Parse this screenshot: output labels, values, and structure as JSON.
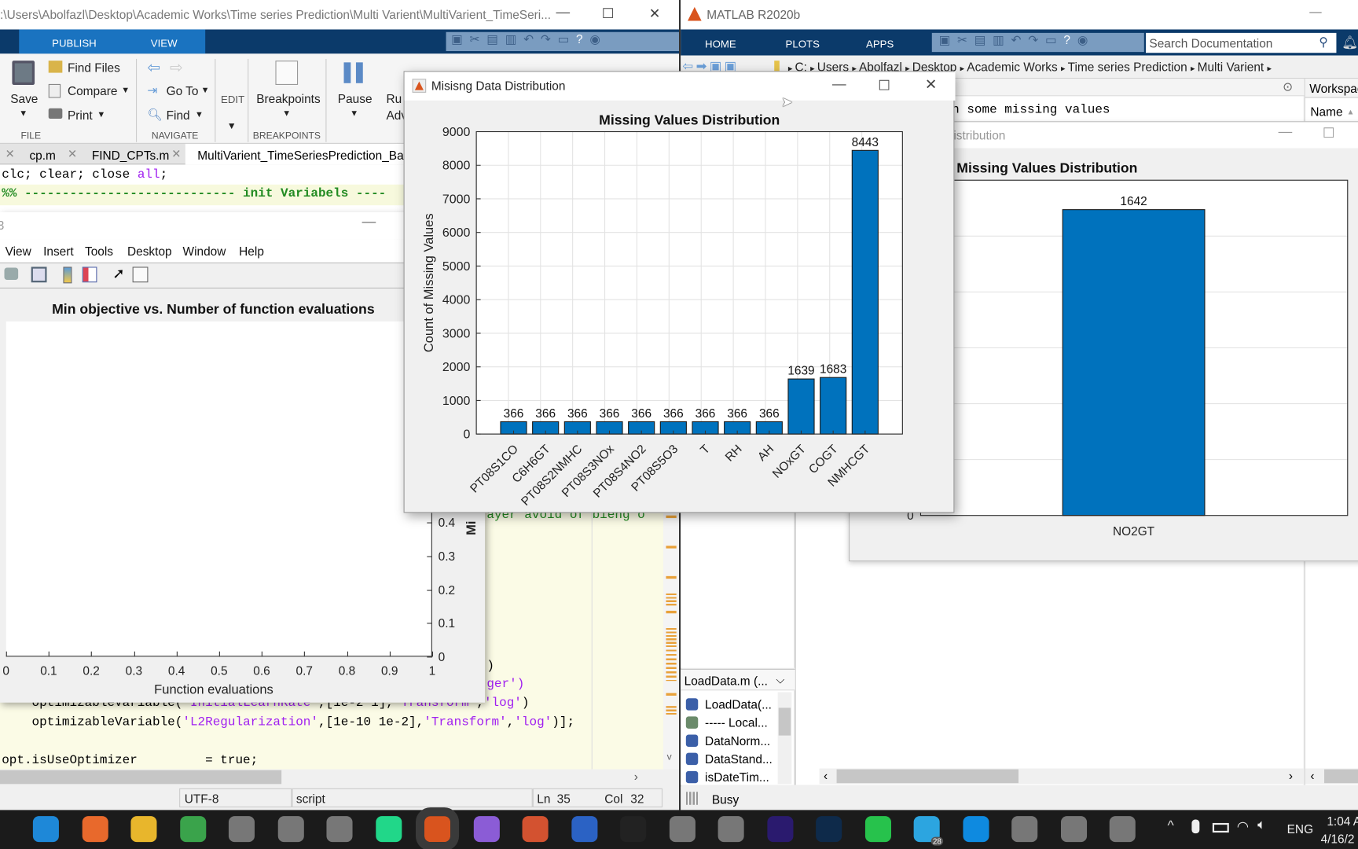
{
  "editor_window": {
    "title": ":\\Users\\Abolfazl\\Desktop\\Academic Works\\Time series Prediction\\Multi Varient\\MultiVarient_TimeSeri...",
    "tabs": [
      "PUBLISH",
      "VIEW"
    ],
    "ribbon": {
      "save": "Save",
      "find_files": "Find Files",
      "compare": "Compare",
      "print": "Print",
      "go_to": "Go To",
      "find": "Find",
      "edit": "EDIT",
      "breakpoints": "Breakpoints",
      "pause": "Pause",
      "run_adv_1": "Ru",
      "run_adv_2": "Adv",
      "groups": {
        "file": "FILE",
        "navigate": "NAVIGATE",
        "breakpoints": "BREAKPOINTS"
      }
    },
    "file_tabs": [
      "cp.m",
      "FIND_CPTs.m",
      "MultiVarient_TimeSeriesPrediction_Baye"
    ],
    "code": {
      "line1": [
        {
          "t": "clc; clear; close ",
          "k": ""
        },
        {
          "t": "all",
          "k": "str"
        },
        {
          "t": ";",
          "k": ""
        }
      ],
      "line2": "%% ---------------------------- init Variabels ----",
      "comment_partial": "ayer avoid of bieng o",
      "paren1": ")",
      "paren2a": "ger",
      "paren2b": "')",
      "line_ilr": [
        {
          "t": "    optimizableVariable(",
          "k": ""
        },
        {
          "t": "'InitialLearnRate'",
          "k": "str"
        },
        {
          "t": ",[1e-2 1],",
          "k": ""
        },
        {
          "t": "'Transform'",
          "k": "str"
        },
        {
          "t": ",",
          "k": ""
        },
        {
          "t": "'log'",
          "k": "str"
        },
        {
          "t": ")",
          "k": ""
        }
      ],
      "line_l2": [
        {
          "t": "    optimizableVariable(",
          "k": ""
        },
        {
          "t": "'L2Regularization'",
          "k": "str"
        },
        {
          "t": ",[1e-10 1e-2],",
          "k": ""
        },
        {
          "t": "'Transform'",
          "k": "str"
        },
        {
          "t": ",",
          "k": ""
        },
        {
          "t": "'log'",
          "k": "str"
        },
        {
          "t": ")];",
          "k": ""
        }
      ],
      "line_opt": "opt.isUseOptimizer         = true;"
    },
    "status": {
      "encoding": "UTF-8",
      "type": "script",
      "ln_label": "Ln",
      "ln": "35",
      "col_label": "Col",
      "col": "32"
    }
  },
  "bayes_figure": {
    "title_frag": "3",
    "menu": [
      "View",
      "Insert",
      "Tools",
      "Desktop",
      "Window",
      "Help"
    ],
    "plot_title": "Min objective vs. Number of function evaluations",
    "xlabel": "Function evaluations",
    "ylabel_partial": "Mi",
    "xticks": [
      "0",
      "0.1",
      "0.2",
      "0.3",
      "0.4",
      "0.5",
      "0.6",
      "0.7",
      "0.8",
      "0.9",
      "1"
    ],
    "yticks": [
      "0",
      "0.1",
      "0.2",
      "0.3",
      "0.4"
    ]
  },
  "matlab_window": {
    "title": "MATLAB R2020b",
    "tabs": [
      "HOME",
      "PLOTS",
      "APPS"
    ],
    "search_placeholder": "Search Documentation",
    "breadcrumb": [
      "C:",
      "Users",
      "Abolfazl",
      "Desktop",
      "Academic Works",
      "Time series Prediction",
      "Multi Varient"
    ],
    "command_text": "n some missing values",
    "workspace_title": "Workspac",
    "workspace_col": "Name",
    "details_dropdown": "LoadData.m  (...",
    "functions": [
      {
        "name": "LoadData(...",
        "icon": "function-icon"
      },
      {
        "name": "----- Local...",
        "icon": "cell-icon"
      },
      {
        "name": "DataNorm...",
        "icon": "function-icon"
      },
      {
        "name": "DataStand...",
        "icon": "function-icon"
      },
      {
        "name": "isDateTim...",
        "icon": "function-icon"
      }
    ],
    "status": "Busy"
  },
  "main_figure": {
    "window_title": "Misisng Data Distribution"
  },
  "second_figure": {
    "window_title_partial": "istribution"
  },
  "chart_data": [
    {
      "type": "bar",
      "title": "Missing Values Distribution",
      "xlabel": "",
      "ylabel": "Count of Missing Values",
      "categories": [
        "PT08S1CO",
        "C6H6GT",
        "PT08S2NMHC",
        "PT08S3NOx",
        "PT08S4NO2",
        "PT08S5O3",
        "T",
        "RH",
        "AH",
        "NOxGT",
        "COGT",
        "NMHCGT"
      ],
      "values": [
        366,
        366,
        366,
        366,
        366,
        366,
        366,
        366,
        366,
        1639,
        1683,
        8443
      ],
      "ylim": [
        0,
        9000
      ],
      "yticks": [
        0,
        1000,
        2000,
        3000,
        4000,
        5000,
        6000,
        7000,
        8000,
        9000
      ],
      "grid": true,
      "data_labels": true,
      "bar_color": "#0072BD"
    },
    {
      "type": "bar",
      "title": "Missing Values Distribution",
      "categories": [
        "NO2GT"
      ],
      "values": [
        1642
      ],
      "ylim": [
        0,
        1800
      ],
      "yticks_visible": [
        0
      ],
      "grid": true,
      "data_labels": true,
      "bar_color": "#0072BD"
    }
  ],
  "taskbar": {
    "apps": [
      "edge-icon",
      "firefox-icon",
      "chrome-icon",
      "download-manager-icon",
      "app-icon",
      "app-icon",
      "app-icon",
      "pycharm-icon",
      "matlab-icon",
      "visual-studio-icon",
      "powerpoint-icon",
      "word-icon",
      "media-player-icon",
      "app-icon",
      "app-icon",
      "premiere-icon",
      "photoshop-icon",
      "money-icon",
      "telegram-icon",
      "skype-icon",
      "app-icon",
      "app-icon",
      "app-icon"
    ],
    "telegram_badge": "28",
    "language": "ENG",
    "time": "1:04 A",
    "date": "4/16/2"
  },
  "colors": {
    "ribbon_dark": "#0b3a6a",
    "ribbon_tab": "#1a73c0",
    "bar": "#0072BD",
    "taskbar": "#1b1b1b"
  }
}
